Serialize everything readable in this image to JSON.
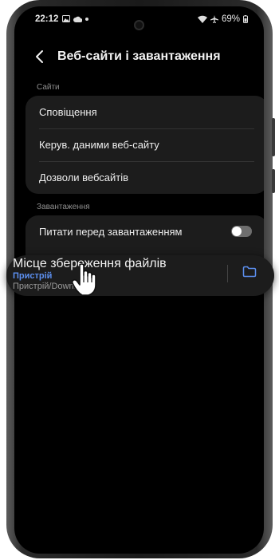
{
  "status_bar": {
    "time": "22:12",
    "battery": "69%",
    "left_icons": [
      "image-icon",
      "cloud-icon",
      "dot-icon"
    ],
    "right_icons": [
      "wifi-icon",
      "airplane-icon",
      "battery-icon"
    ]
  },
  "header": {
    "title": "Веб-сайти і завантаження",
    "back_icon": "back-arrow-icon"
  },
  "sections": {
    "sites": {
      "label": "Сайти",
      "items": [
        "Сповіщення",
        "Керув. даними веб-сайту",
        "Дозволи вебсайтів"
      ]
    },
    "downloads": {
      "label": "Завантаження",
      "ask_before_download": {
        "label": "Питати перед завантаженням",
        "enabled": false
      },
      "storage_location": {
        "label": "Місце збереження файлів",
        "value": "Пристрій",
        "path": "Пристрій/Downl"
      }
    }
  },
  "colors": {
    "accent": "#5c8fef",
    "background": "#000000",
    "card": "#1c1c1c"
  }
}
